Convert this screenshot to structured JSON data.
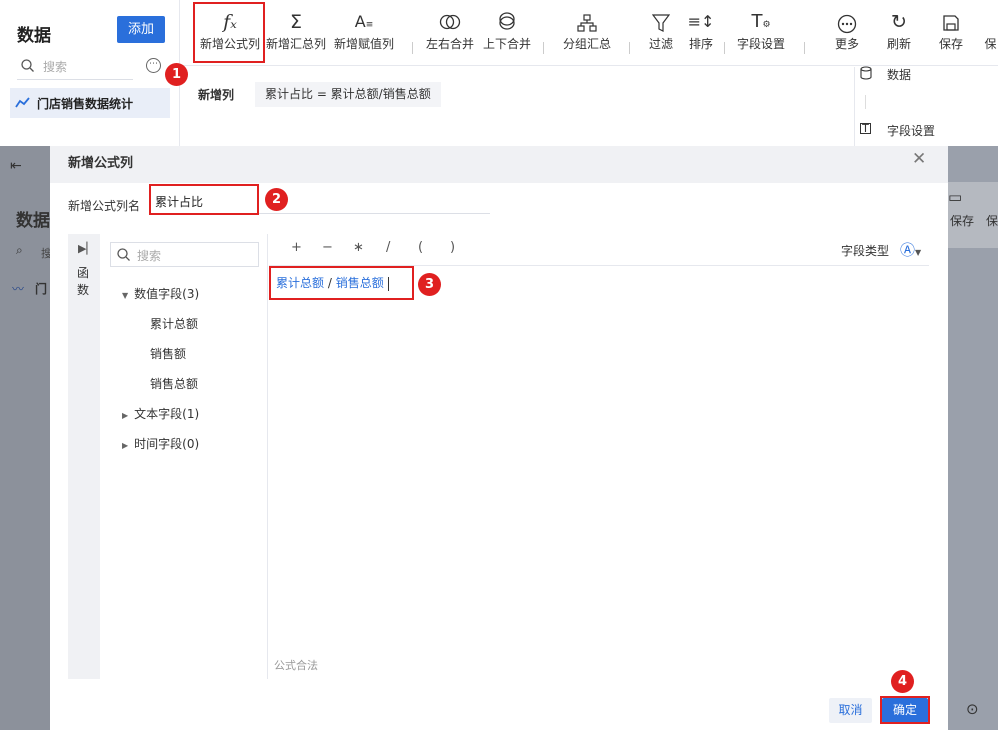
{
  "app": {
    "sidebar_title": "数据",
    "add_button": "添加",
    "search_placeholder": "搜索",
    "table_name": "门店销售数据统计"
  },
  "toolbar": {
    "items": [
      {
        "label": "新增公式列",
        "icon": "fx-icon",
        "glyph": "fx"
      },
      {
        "label": "新增汇总列",
        "icon": "sigma-icon",
        "glyph": "Σ"
      },
      {
        "label": "新增赋值列",
        "icon": "assign-icon",
        "glyph": "A="
      },
      {
        "label": "左右合并",
        "icon": "merge-lr-icon",
        "glyph": "⊂⊃"
      },
      {
        "label": "上下合并",
        "icon": "merge-ud-icon",
        "glyph": "⊖"
      },
      {
        "label": "分组汇总",
        "icon": "group-icon",
        "glyph": "⊞"
      },
      {
        "label": "过滤",
        "icon": "filter-icon",
        "glyph": "▽"
      },
      {
        "label": "排序",
        "icon": "sort-icon",
        "glyph": "≡↕"
      },
      {
        "label": "字段设置",
        "icon": "field-settings-icon",
        "glyph": "T"
      },
      {
        "label": "更多",
        "icon": "more-icon",
        "glyph": "⋯"
      },
      {
        "label": "刷新",
        "icon": "refresh-icon",
        "glyph": "↻"
      },
      {
        "label": "保存",
        "icon": "save-icon",
        "glyph": "▭"
      },
      {
        "label": "保",
        "icon": "save-icon",
        "glyph": ""
      }
    ]
  },
  "new_column_bar": {
    "label": "新增列",
    "formula": "累计占比 = 累计总额/销售总额"
  },
  "right_panel": {
    "data_label": "数据",
    "field_settings_label": "字段设置"
  },
  "overlay": {
    "sidebar_title": "数据",
    "sidebar_item_prefix": "门",
    "sidebar_search_prefix": "搜"
  },
  "dialog": {
    "title": "新增公式列",
    "name_label": "新增公式列名",
    "name_value": "累计占比",
    "function_tab": [
      "函",
      "数"
    ],
    "field_search_placeholder": "搜索",
    "tree": {
      "numeric_group": "数值字段(3)",
      "numeric_fields": [
        "累计总额",
        "销售额",
        "销售总额"
      ],
      "text_group": "文本字段(1)",
      "time_group": "时间字段(0)"
    },
    "operators": [
      "+",
      "−",
      "∗",
      "/",
      "(",
      ")"
    ],
    "field_type_label": "字段类型",
    "formula": {
      "field1": "累计总额",
      "operator": "/",
      "field2": "销售总额"
    },
    "formula_status": "公式合法",
    "cancel": "取消",
    "ok": "确定"
  },
  "annotations": [
    "1",
    "2",
    "3",
    "4"
  ],
  "colors": {
    "primary": "#2a6fdb",
    "annotation": "#e02020",
    "overlay": "#9aa0ab"
  }
}
